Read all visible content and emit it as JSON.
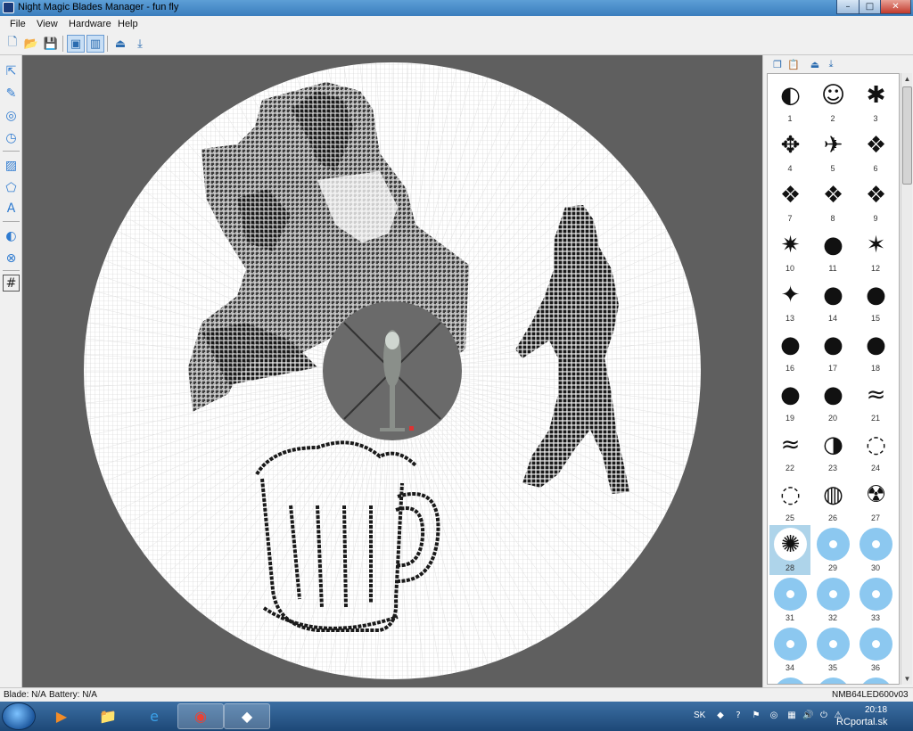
{
  "window": {
    "title": "Night Magic Blades Manager - fun fly",
    "controls": {
      "minimize": "–",
      "maximize": "□",
      "close": "✕"
    }
  },
  "menu": [
    "File",
    "View",
    "Hardware",
    "Help"
  ],
  "toolbar": {
    "buttons": [
      {
        "name": "new-file-icon",
        "glyph": "🗋"
      },
      {
        "name": "open-folder-icon",
        "glyph": "📂"
      },
      {
        "name": "save-icon",
        "glyph": "💾"
      },
      {
        "name": "single-view-icon",
        "glyph": "▣",
        "pressed": true
      },
      {
        "name": "dual-view-icon",
        "glyph": "▥",
        "pressed": true
      },
      {
        "name": "upload-icon",
        "glyph": "⏏"
      },
      {
        "name": "download-icon",
        "glyph": "⤓"
      }
    ]
  },
  "tools": [
    {
      "name": "select-tool-icon",
      "glyph": "⇱"
    },
    {
      "name": "pencil-tool-icon",
      "glyph": "✎"
    },
    {
      "name": "circle-tool-icon",
      "glyph": "◎"
    },
    {
      "name": "clock-tool-icon",
      "glyph": "◷"
    },
    {
      "name": "image-tool-icon",
      "glyph": "▨"
    },
    {
      "name": "shapes-tool-icon",
      "glyph": "⬠"
    },
    {
      "name": "text-tool-icon",
      "glyph": "A"
    },
    {
      "name": "mirror-tool-icon",
      "glyph": "◐"
    },
    {
      "name": "clear-tool-icon",
      "glyph": "⊗"
    },
    {
      "name": "grid-tool-icon",
      "glyph": "#"
    }
  ],
  "gallery": {
    "toolbar": [
      {
        "name": "copy-icon",
        "glyph": "❐"
      },
      {
        "name": "paste-icon",
        "glyph": "📋"
      },
      {
        "name": "upload-blade-icon",
        "glyph": "⏏"
      },
      {
        "name": "download-blade-icon",
        "glyph": "⤓"
      }
    ],
    "items": [
      {
        "label": "1",
        "kind": "art",
        "glyph": "◐"
      },
      {
        "label": "2",
        "kind": "art",
        "glyph": "☺"
      },
      {
        "label": "3",
        "kind": "art",
        "glyph": "✱"
      },
      {
        "label": "4",
        "kind": "art",
        "glyph": "✥"
      },
      {
        "label": "5",
        "kind": "art",
        "glyph": "✈"
      },
      {
        "label": "6",
        "kind": "art",
        "glyph": "❖"
      },
      {
        "label": "7",
        "kind": "art",
        "glyph": "❖"
      },
      {
        "label": "8",
        "kind": "art",
        "glyph": "❖"
      },
      {
        "label": "9",
        "kind": "art",
        "glyph": "❖"
      },
      {
        "label": "10",
        "kind": "art",
        "glyph": "✷"
      },
      {
        "label": "11",
        "kind": "art",
        "glyph": "●"
      },
      {
        "label": "12",
        "kind": "art",
        "glyph": "✶"
      },
      {
        "label": "13",
        "kind": "art",
        "glyph": "✦"
      },
      {
        "label": "14",
        "kind": "art",
        "glyph": "●"
      },
      {
        "label": "15",
        "kind": "art",
        "glyph": "●"
      },
      {
        "label": "16",
        "kind": "art",
        "glyph": "●"
      },
      {
        "label": "17",
        "kind": "art",
        "glyph": "●"
      },
      {
        "label": "18",
        "kind": "art",
        "glyph": "●"
      },
      {
        "label": "19",
        "kind": "art",
        "glyph": "●"
      },
      {
        "label": "20",
        "kind": "art",
        "glyph": "●"
      },
      {
        "label": "21",
        "kind": "art",
        "glyph": "≈"
      },
      {
        "label": "22",
        "kind": "art",
        "glyph": "≈"
      },
      {
        "label": "23",
        "kind": "art",
        "glyph": "◑"
      },
      {
        "label": "24",
        "kind": "art",
        "glyph": "◌"
      },
      {
        "label": "25",
        "kind": "art",
        "glyph": "◌"
      },
      {
        "label": "26",
        "kind": "art",
        "glyph": "◍"
      },
      {
        "label": "27",
        "kind": "art",
        "glyph": "☢"
      },
      {
        "label": "28",
        "kind": "art",
        "glyph": "✺",
        "selected": true
      },
      {
        "label": "29",
        "kind": "blank"
      },
      {
        "label": "30",
        "kind": "blank"
      },
      {
        "label": "31",
        "kind": "blank"
      },
      {
        "label": "32",
        "kind": "blank"
      },
      {
        "label": "33",
        "kind": "blank"
      },
      {
        "label": "34",
        "kind": "blank"
      },
      {
        "label": "35",
        "kind": "blank"
      },
      {
        "label": "36",
        "kind": "blank"
      },
      {
        "label": "",
        "kind": "blank"
      },
      {
        "label": "",
        "kind": "blank"
      },
      {
        "label": "",
        "kind": "blank"
      }
    ]
  },
  "status": {
    "blade": "Blade: N/A",
    "battery": "Battery: N/A",
    "firmware": "NMB64LED600v03"
  },
  "taskbar": {
    "apps": [
      {
        "name": "media-player-icon",
        "glyph": "▶",
        "color": "#f28c28"
      },
      {
        "name": "explorer-icon",
        "glyph": "📁",
        "color": "#f2c94c"
      },
      {
        "name": "internet-explorer-icon",
        "glyph": "e",
        "color": "#3aa0e8"
      },
      {
        "name": "chrome-icon",
        "glyph": "◉",
        "color": "#e94235",
        "active": true
      },
      {
        "name": "blades-manager-icon",
        "glyph": "◆",
        "color": "#ffffff",
        "active": true
      }
    ],
    "tray": {
      "lang": "SK",
      "time": "20:18",
      "watermark": "RCportal.sk"
    }
  },
  "colors": {
    "disc": "#ffffff",
    "grid": "#cfcfcf",
    "pixel": "#1a1a1a",
    "pixel_mid": "#3c3c3c",
    "hub": "#6a6a6a",
    "canvas_bg": "#5f5f5f"
  }
}
